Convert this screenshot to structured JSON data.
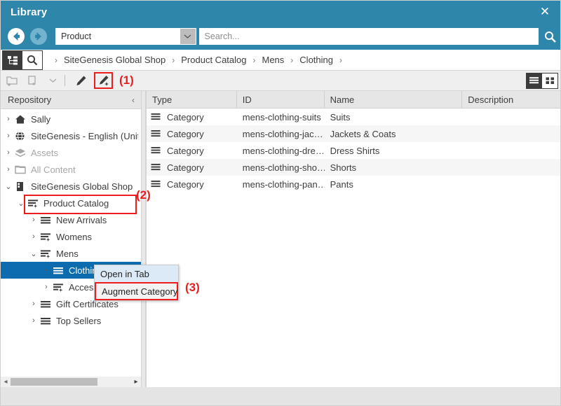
{
  "window": {
    "title": "Library",
    "close_label": "✕",
    "accent_color": "#2e86ab",
    "selection_color": "#0d6cad",
    "annotation_color": "#ee1c1c"
  },
  "navbar": {
    "back_icon": "back-arrow-icon",
    "forward_icon": "forward-arrow-icon",
    "type_filter_value": "Product",
    "search_value": "",
    "search_placeholder": "Search...",
    "search_button_icon": "search-icon"
  },
  "breadcrumb": {
    "tree_mode_icon": "tree-view-icon",
    "search_mode_icon": "search-icon",
    "leading_separator": "›",
    "separator": "›",
    "items": [
      {
        "label": "SiteGenesis Global Shop"
      },
      {
        "label": "Product Catalog"
      },
      {
        "label": "Mens"
      },
      {
        "label": "Clothing"
      }
    ]
  },
  "toolbar": {
    "new_folder_icon": "new-folder-icon",
    "new_document_icon": "new-document-icon",
    "more_icon": "chevron-down-icon",
    "edit_icon": "pencil-icon",
    "augment_icon": "pencil-sparkle-icon",
    "annotation_1": "(1)",
    "view_list_icon": "list-view-icon",
    "view_grid_icon": "grid-view-icon"
  },
  "repository": {
    "title": "Repository",
    "collapse_icon": "‹",
    "annotation_2": "(2)",
    "tree": [
      {
        "label": "Sally",
        "icon": "home-icon",
        "indent": 0,
        "twisty": "›",
        "muted": false,
        "selected": false,
        "boxed": false
      },
      {
        "label": "SiteGenesis - English (Unite",
        "icon": "globe-icon",
        "indent": 0,
        "twisty": "›",
        "muted": false,
        "selected": false,
        "boxed": false
      },
      {
        "label": "Assets",
        "icon": "assets-icon",
        "indent": 0,
        "twisty": "›",
        "muted": true,
        "selected": false,
        "boxed": false
      },
      {
        "label": "All Content",
        "icon": "folder-icon",
        "indent": 0,
        "twisty": "›",
        "muted": true,
        "selected": false,
        "boxed": false
      },
      {
        "label": "SiteGenesis Global Shop",
        "icon": "shop-icon",
        "indent": 0,
        "twisty": "⌄",
        "muted": false,
        "selected": false,
        "boxed": false
      },
      {
        "label": "Product Catalog",
        "icon": "catalog-star-icon",
        "indent": 1,
        "twisty": "⌄",
        "muted": false,
        "selected": false,
        "boxed": true
      },
      {
        "label": "New Arrivals",
        "icon": "category-icon",
        "indent": 2,
        "twisty": "›",
        "muted": false,
        "selected": false,
        "boxed": false
      },
      {
        "label": "Womens",
        "icon": "category-star-icon",
        "indent": 2,
        "twisty": "›",
        "muted": false,
        "selected": false,
        "boxed": false
      },
      {
        "label": "Mens",
        "icon": "category-star-icon",
        "indent": 2,
        "twisty": "⌄",
        "muted": false,
        "selected": false,
        "boxed": false
      },
      {
        "label": "Clothing",
        "icon": "category-icon",
        "indent": 3,
        "twisty": "›",
        "muted": false,
        "selected": true,
        "boxed": false
      },
      {
        "label": "Accessories",
        "icon": "category-star-icon",
        "indent": 3,
        "twisty": "›",
        "muted": false,
        "selected": false,
        "boxed": false
      },
      {
        "label": "Gift Certificates",
        "icon": "category-icon",
        "indent": 2,
        "twisty": "›",
        "muted": false,
        "selected": false,
        "boxed": false
      },
      {
        "label": "Top Sellers",
        "icon": "category-icon",
        "indent": 2,
        "twisty": "›",
        "muted": false,
        "selected": false,
        "boxed": false
      }
    ]
  },
  "context_menu": {
    "annotation_3": "(3)",
    "items": [
      {
        "label": "Open in Tab",
        "hover": true,
        "boxed": false
      },
      {
        "label": "Augment Category",
        "hover": false,
        "boxed": true
      }
    ]
  },
  "grid": {
    "columns": [
      "Type",
      "ID",
      "Name",
      "Description"
    ],
    "row_icon": "category-icon",
    "rows": [
      {
        "type": "Category",
        "id": "mens-clothing-suits",
        "name": "Suits",
        "description": ""
      },
      {
        "type": "Category",
        "id": "mens-clothing-jac…",
        "name": "Jackets & Coats",
        "description": ""
      },
      {
        "type": "Category",
        "id": "mens-clothing-dre…",
        "name": "Dress Shirts",
        "description": ""
      },
      {
        "type": "Category",
        "id": "mens-clothing-sho…",
        "name": "Shorts",
        "description": ""
      },
      {
        "type": "Category",
        "id": "mens-clothing-pan…",
        "name": "Pants",
        "description": ""
      }
    ]
  },
  "scrollbar": {
    "left_arrow": "◂",
    "right_arrow": "▸"
  }
}
